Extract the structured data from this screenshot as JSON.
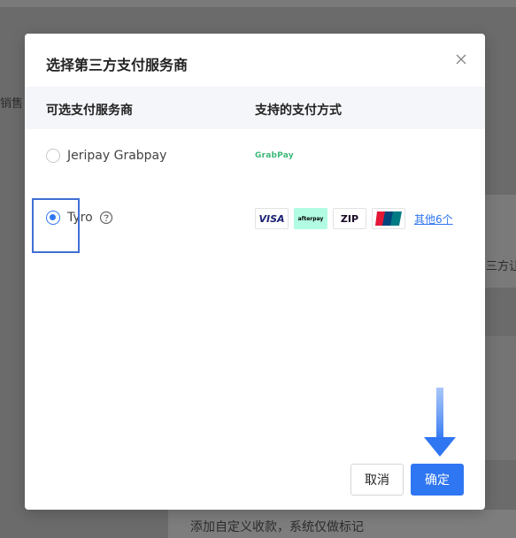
{
  "background": {
    "left_text": "销售",
    "right_text": "三方让",
    "bottom_text": "添加自定义收款，系统仅做标记"
  },
  "modal": {
    "title": "选择第三方支付服务商",
    "close_icon": "close-icon"
  },
  "table": {
    "headers": {
      "provider": "可选支付服务商",
      "methods": "支持的支付方式"
    },
    "rows": [
      {
        "provider": "Jeripay Grabpay",
        "selected": false,
        "methods": [
          {
            "name": "grabpay-logo",
            "text": "GrabPay"
          }
        ]
      },
      {
        "provider": "Tyro",
        "selected": true,
        "help_icon": "question-circle-icon",
        "methods": [
          {
            "name": "visa-logo",
            "text": "VISA"
          },
          {
            "name": "afterpay-logo",
            "text": "afterpay"
          },
          {
            "name": "zip-logo",
            "text": "ZIP"
          },
          {
            "name": "unionpay-logo",
            "text": "UnionPay 银联"
          }
        ],
        "more_link": "其他6个"
      }
    ]
  },
  "footer": {
    "cancel_label": "取消",
    "confirm_label": "确定"
  },
  "colors": {
    "accent": "#2f76f2",
    "annotation_box": "#3f6fd3",
    "annotation_arrow": "#2f76f2",
    "overlay": "#6b6b6b",
    "grabpay_green": "#3cb878",
    "afterpay_mint": "#b2fce4"
  }
}
